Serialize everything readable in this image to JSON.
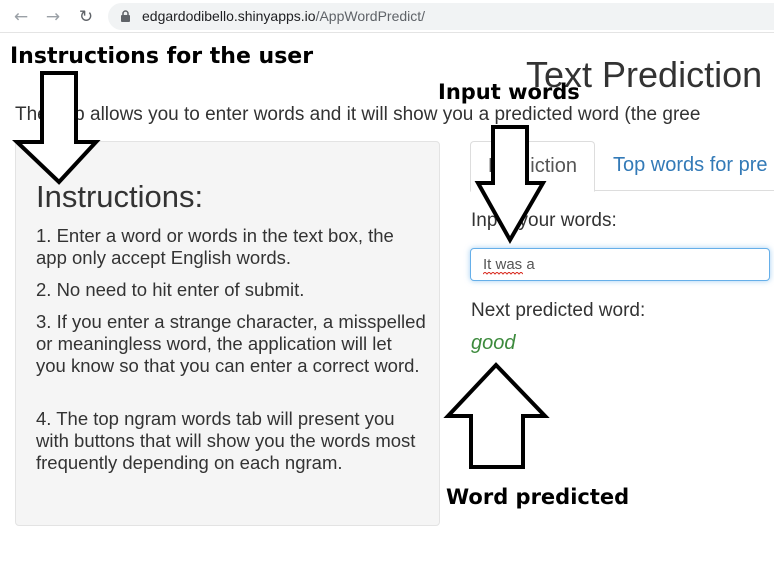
{
  "browser": {
    "back_icon": "arrow-left-icon",
    "forward_icon": "arrow-right-icon",
    "reload_icon": "reload-icon",
    "lock_icon": "lock-icon",
    "url_host": "edgardodibello.shinyapps.io",
    "url_path": "/AppWordPredict/"
  },
  "app": {
    "title": "Text Prediction",
    "description": "The app allows you to enter words and it will show you a predicted word (the gree"
  },
  "sidebar": {
    "title": "Instructions:",
    "paragraphs": [
      "1. Enter a word or words in the text box, the app only accept English words.",
      "2. No need to hit enter of submit.",
      "3. If you enter a strange character, a misspelled or meaningless word, the application will let you know so that you can enter a correct word.",
      "4. The top ngram words tab will present you with buttons that will show you the words most frequently depending on each ngram."
    ]
  },
  "tabs": [
    {
      "label": "Prediction",
      "active": true
    },
    {
      "label": "Top words for pre",
      "active": false
    }
  ],
  "main": {
    "input_label": "Input your words:",
    "input_value": "It was a",
    "prediction_label": "Next predicted word:",
    "predicted_word": "good",
    "predicted_color": "#3c8a3c"
  },
  "annotations": {
    "instructions_label": "Instructions for the user",
    "input_label": "Input words",
    "prediction_label": "Word predicted"
  }
}
